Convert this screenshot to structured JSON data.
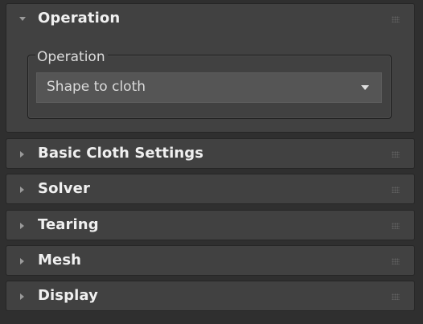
{
  "rollouts": [
    {
      "title": "Operation",
      "expanded": true
    },
    {
      "title": "Basic Cloth Settings",
      "expanded": false
    },
    {
      "title": "Solver",
      "expanded": false
    },
    {
      "title": "Tearing",
      "expanded": false
    },
    {
      "title": "Mesh",
      "expanded": false
    },
    {
      "title": "Display",
      "expanded": false
    }
  ],
  "operation": {
    "group_label": "Operation",
    "dropdown_value": "Shape to cloth"
  },
  "icons": {
    "expanded": "triangle-down-icon",
    "collapsed": "triangle-right-icon",
    "grip": "drag-grip-icon",
    "dropdown": "dropdown-arrow-icon"
  },
  "colors": {
    "background": "#2f2f2f",
    "rollout": "#414141",
    "text": "#f0f0f0",
    "dropdown": "#555555"
  }
}
